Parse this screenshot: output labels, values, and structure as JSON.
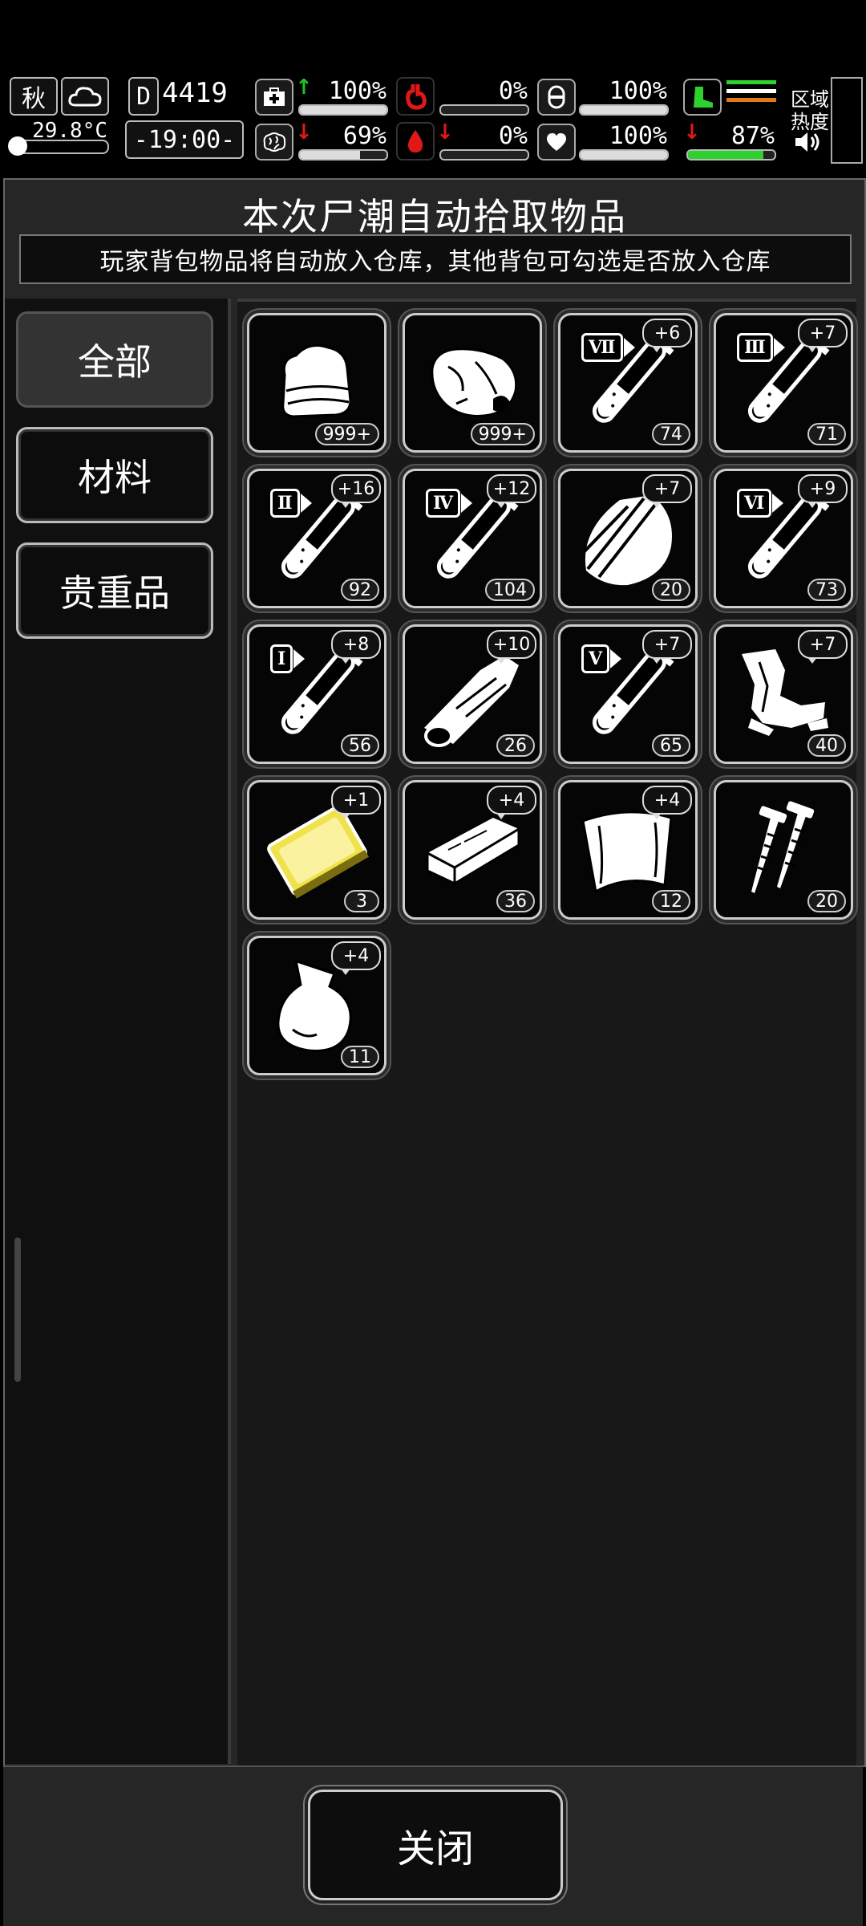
{
  "hud": {
    "season": "秋",
    "day_counter": "4419",
    "day_box": "D",
    "temperature": "29.8°C",
    "time": "-19:00-",
    "health_pct": "100%",
    "hunger_pct": "0%",
    "armor_pct": "100%",
    "sanity_pct": "69%",
    "thirst_pct": "0%",
    "heart_pct": "100%",
    "stamina_pct": "87%",
    "zone_heat_label_1": "区域",
    "zone_heat_label_2": "热度",
    "health_level": 1.0,
    "hunger_level": 0.0,
    "armor_level": 1.0,
    "sanity_level": 0.69,
    "thirst_level": 0.0,
    "heart_level": 1.0,
    "stamina_level": 0.87,
    "colors": {
      "up_arrow": "#1ec41e",
      "down_arrow": "#e01818",
      "stamina": "#2ed12e",
      "stomach": "#e01818"
    }
  },
  "panel": {
    "title": "本次尸潮自动拾取物品",
    "subtitle": "玩家背包物品将自动放入仓库，其他背包可勾选是否放入仓库"
  },
  "tabs": [
    {
      "label": "全部",
      "active": true
    },
    {
      "label": "材料",
      "active": false
    },
    {
      "label": "贵重品",
      "active": false
    }
  ],
  "items": [
    {
      "icon": "cloth-icon",
      "count": "999+",
      "bonus": ""
    },
    {
      "icon": "meat-icon",
      "count": "999+",
      "bonus": ""
    },
    {
      "icon": "test-tube-icon",
      "tier": "Ⅶ",
      "count": "74",
      "bonus": "+6"
    },
    {
      "icon": "test-tube-icon",
      "tier": "Ⅲ",
      "count": "71",
      "bonus": "+7"
    },
    {
      "icon": "test-tube-icon",
      "tier": "Ⅱ",
      "count": "92",
      "bonus": "+16"
    },
    {
      "icon": "test-tube-icon",
      "tier": "Ⅳ",
      "count": "104",
      "bonus": "+12"
    },
    {
      "icon": "scrap-shell-icon",
      "count": "20",
      "bonus": "+7"
    },
    {
      "icon": "test-tube-icon",
      "tier": "Ⅵ",
      "count": "73",
      "bonus": "+9"
    },
    {
      "icon": "test-tube-icon",
      "tier": "Ⅰ",
      "count": "56",
      "bonus": "+8"
    },
    {
      "icon": "wood-log-icon",
      "count": "26",
      "bonus": "+10"
    },
    {
      "icon": "test-tube-icon",
      "tier": "Ⅴ",
      "count": "65",
      "bonus": "+7"
    },
    {
      "icon": "scrap-metal-icon",
      "count": "40",
      "bonus": "+7"
    },
    {
      "icon": "gold-bar-icon",
      "count": "3",
      "bonus": "+1"
    },
    {
      "icon": "plank-icon",
      "count": "36",
      "bonus": "+4"
    },
    {
      "icon": "sheet-metal-icon",
      "count": "12",
      "bonus": "+4"
    },
    {
      "icon": "nails-icon",
      "count": "20",
      "bonus": ""
    },
    {
      "icon": "plastic-bag-icon",
      "count": "11",
      "bonus": "+4"
    }
  ],
  "footer": {
    "close_label": "关闭"
  }
}
